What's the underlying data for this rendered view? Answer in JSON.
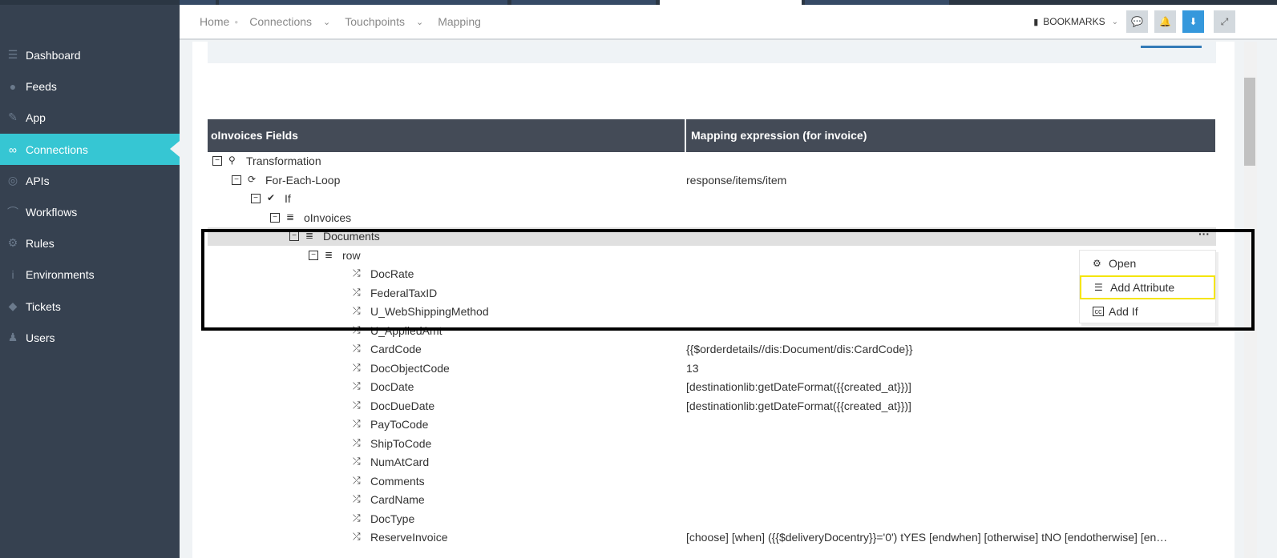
{
  "sidebar": {
    "items": [
      {
        "label": "Dashboard",
        "icon": "database-icon"
      },
      {
        "label": "Feeds",
        "icon": "comments-icon"
      },
      {
        "label": "App",
        "icon": "puzzle-icon"
      },
      {
        "label": "Connections",
        "icon": "link-icon",
        "active": true
      },
      {
        "label": "APIs",
        "icon": "lifebuoy-icon"
      },
      {
        "label": "Workflows",
        "icon": "workflow-icon"
      },
      {
        "label": "Rules",
        "icon": "gear-icon"
      },
      {
        "label": "Environments",
        "icon": "info-icon"
      },
      {
        "label": "Tickets",
        "icon": "tag-icon"
      },
      {
        "label": "Users",
        "icon": "user-icon"
      }
    ]
  },
  "breadcrumb": {
    "home": "Home",
    "connections": "Connections",
    "touchpoints": "Touchpoints",
    "mapping": "Mapping"
  },
  "header": {
    "bookmarks": "BOOKMARKS"
  },
  "table": {
    "col1": "oInvoices Fields",
    "col2": "Mapping expression (for invoice)"
  },
  "tree": [
    {
      "label": "Transformation",
      "level": 0,
      "value": ""
    },
    {
      "label": "For-Each-Loop",
      "level": 1,
      "value": "response/items/item"
    },
    {
      "label": "If",
      "level": 2,
      "value": ""
    },
    {
      "label": "oInvoices",
      "level": 3,
      "value": ""
    },
    {
      "label": "Documents",
      "level": 4,
      "value": ""
    },
    {
      "label": "row",
      "level": 5,
      "value": ""
    },
    {
      "label": "DocRate",
      "level": 6,
      "value": ""
    },
    {
      "label": "FederalTaxID",
      "level": 6,
      "value": ""
    },
    {
      "label": "U_WebShippingMethod",
      "level": 6,
      "value": ""
    },
    {
      "label": "U_AppliedAmt",
      "level": 6,
      "value": ""
    },
    {
      "label": "CardCode",
      "level": 6,
      "value": "{{$orderdetails//dis:Document/dis:CardCode}}"
    },
    {
      "label": "DocObjectCode",
      "level": 6,
      "value": "13"
    },
    {
      "label": "DocDate",
      "level": 6,
      "value": "[destinationlib:getDateFormat({{created_at}})]"
    },
    {
      "label": "DocDueDate",
      "level": 6,
      "value": "[destinationlib:getDateFormat({{created_at}})]"
    },
    {
      "label": "PayToCode",
      "level": 6,
      "value": ""
    },
    {
      "label": "ShipToCode",
      "level": 6,
      "value": ""
    },
    {
      "label": "NumAtCard",
      "level": 6,
      "value": ""
    },
    {
      "label": "Comments",
      "level": 6,
      "value": ""
    },
    {
      "label": "CardName",
      "level": 6,
      "value": ""
    },
    {
      "label": "DocType",
      "level": 6,
      "value": ""
    },
    {
      "label": "ReserveInvoice",
      "level": 6,
      "value": "[choose] [when] ({{$deliveryDocentry}}='0') tYES [endwhen] [otherwise] tNO [endotherwise] [en…"
    }
  ],
  "context_menu": {
    "open": "Open",
    "add_attribute": "Add Attribute",
    "add_if": "Add If"
  }
}
